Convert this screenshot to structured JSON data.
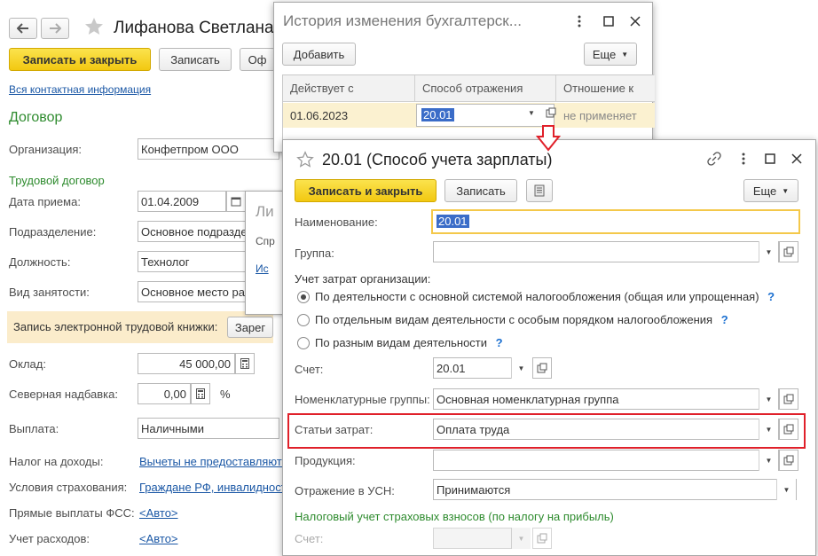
{
  "main": {
    "title": "Лифанова Светлана",
    "btn_save_close": "Записать и закрыть",
    "btn_save": "Записать",
    "btn_trunc": "Оф",
    "contact_link": "Вся контактная информация",
    "section_contract": "Договор",
    "org_label": "Организация:",
    "org_value": "Конфетпром ООО",
    "labor_header": "Трудовой договор",
    "hire_label": "Дата приема:",
    "hire_value": "01.04.2009",
    "dept_label": "Подразделение:",
    "dept_value": "Основное подразде",
    "pos_label": "Должность:",
    "pos_value": "Технолог",
    "emp_label": "Вид занятости:",
    "emp_value": "Основное место ра",
    "ewb_label": "Запись электронной трудовой книжки:",
    "ewb_btn": "Зарег",
    "salary_label": "Оклад:",
    "salary_value": "45 000,00",
    "north_label": "Северная надбавка:",
    "north_value": "0,00",
    "north_unit": "%",
    "payment_label": "Выплата:",
    "payment_value": "Наличными",
    "tax_label": "Налог на доходы:",
    "tax_link": "Вычеты не предоставляютс",
    "ins_label": "Условия страхования:",
    "ins_link": "Граждане РФ, инвалидност",
    "fss_label": "Прямые выплаты ФСС:",
    "fss_link": "<Авто>",
    "exp_label": "Учет расходов:",
    "exp_link": "<Авто>"
  },
  "small_popup": {
    "title": "Ли",
    "text1": "Спр",
    "link": "Ис"
  },
  "history_window": {
    "title": "История изменения бухгалтерск...",
    "btn_add": "Добавить",
    "btn_more": "Еще",
    "columns": [
      "Действует с",
      "Способ отражения",
      "Отношение к"
    ],
    "row": {
      "date": "01.06.2023",
      "method": "20.01",
      "relation": "не применяет"
    }
  },
  "method_window": {
    "title": "20.01 (Способ учета зарплаты)",
    "btn_save_close": "Записать и закрыть",
    "btn_save": "Записать",
    "btn_more": "Еще",
    "name_label": "Наименование:",
    "name_value": "20.01",
    "group_label": "Группа:",
    "group_value": "",
    "cost_org_label": "Учет затрат организации:",
    "radio_options": [
      "По деятельности с основной системой налогообложения (общая или упрощенная)",
      "По отдельным видам деятельности с особым порядком налогообложения",
      "По разным видам деятельности"
    ],
    "help_mark": "?",
    "account_label": "Счет:",
    "account_value": "20.01",
    "nomgroup_label": "Номенклатурные группы:",
    "nomgroup_value": "Основная номенклатурная группа",
    "costitem_label": "Статьи затрат:",
    "costitem_value": "Оплата труда",
    "product_label": "Продукция:",
    "product_value": "",
    "usn_label": "Отражение в УСН:",
    "usn_value": "Принимаются",
    "tax_header": "Налоговый учет страховых взносов (по налогу на прибыль)",
    "tax_account_label": "Счет:",
    "tax_account_value": ""
  },
  "colors": {
    "accent_yellow": "#f2c811",
    "highlight_red": "#e0202a",
    "green_header": "#2e8b2e",
    "link_blue": "#1a57a5"
  }
}
